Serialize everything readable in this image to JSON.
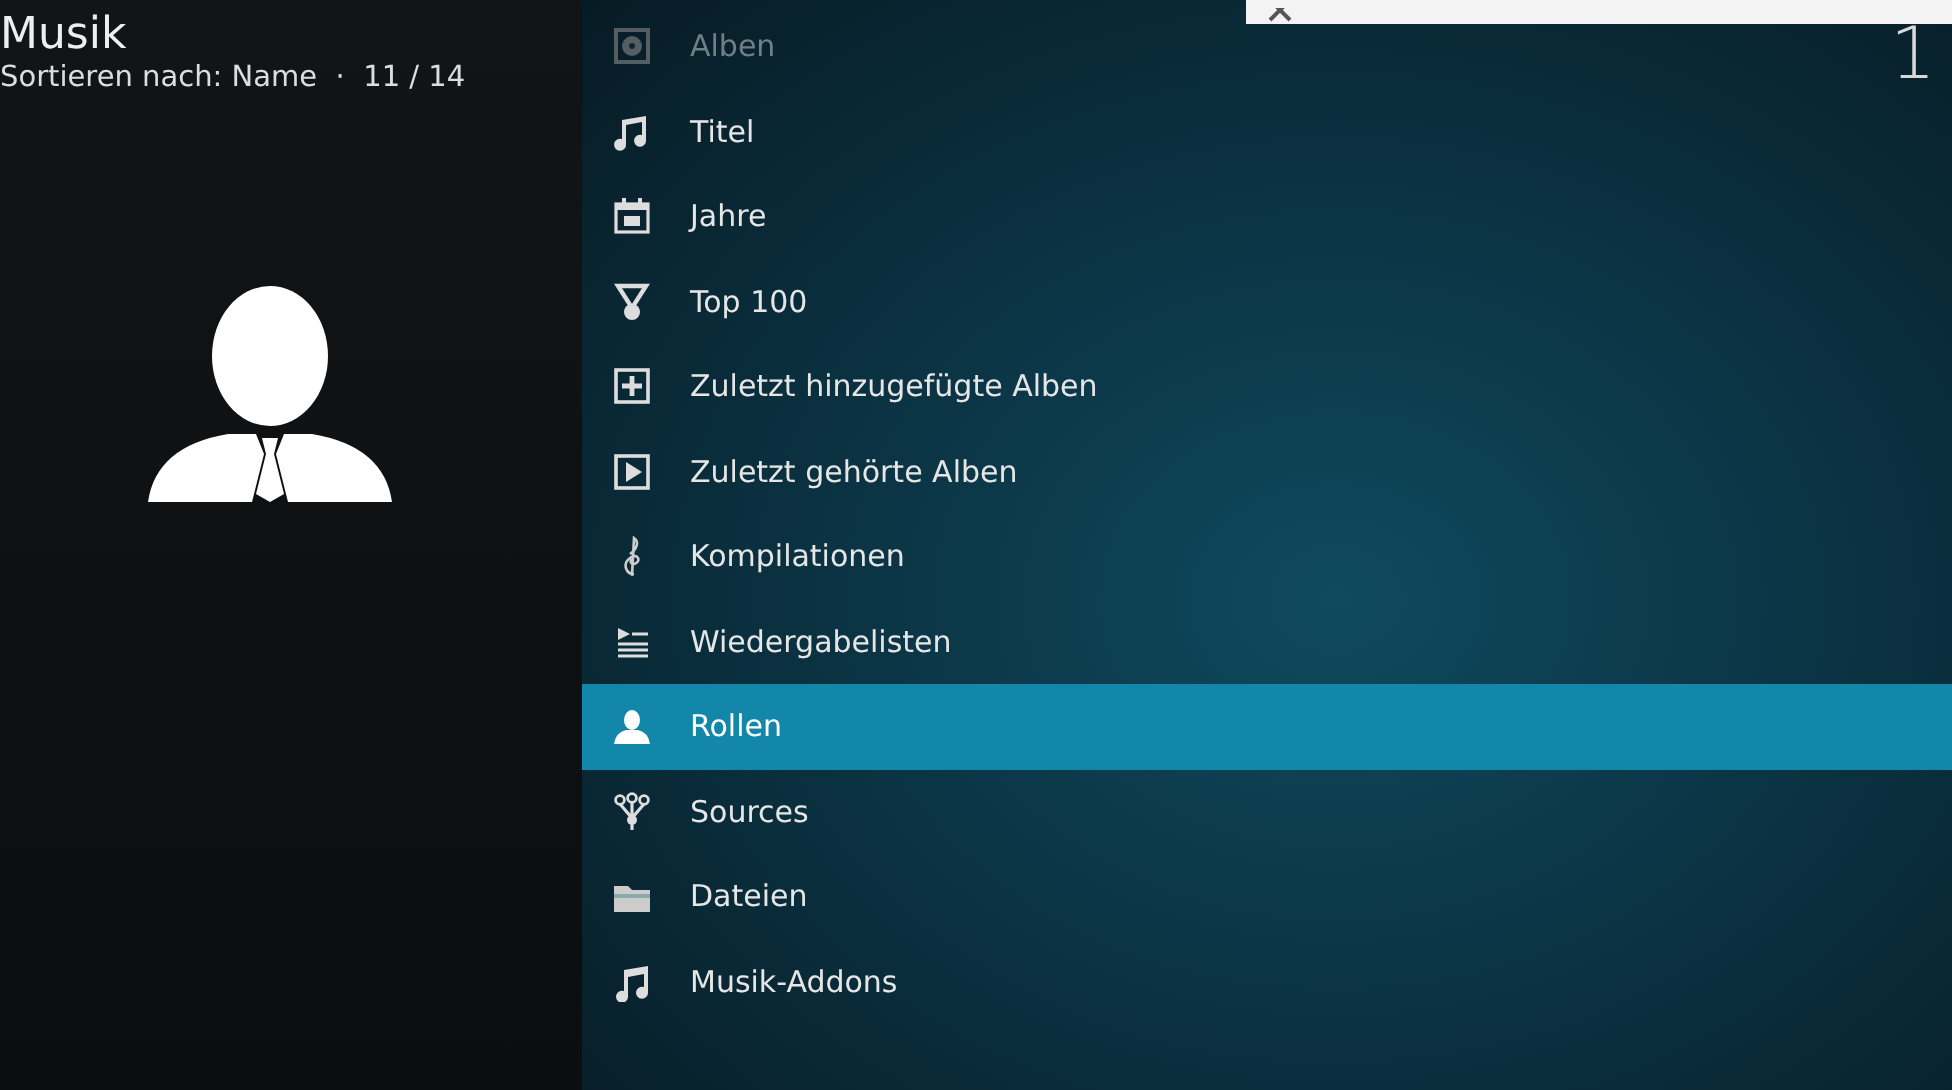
{
  "header": {
    "title": "Musik",
    "sort_info": "Sortieren nach: Name  ·  11 / 14"
  },
  "clock": {
    "time": "1"
  },
  "menu": {
    "items": [
      {
        "label": "Alben",
        "selected": false,
        "faded": true
      },
      {
        "label": "Titel",
        "selected": false,
        "faded": false
      },
      {
        "label": "Jahre",
        "selected": false,
        "faded": false
      },
      {
        "label": "Top 100",
        "selected": false,
        "faded": false
      },
      {
        "label": "Zuletzt hinzugefügte Alben",
        "selected": false,
        "faded": false
      },
      {
        "label": "Zuletzt gehörte Alben",
        "selected": false,
        "faded": false
      },
      {
        "label": "Kompilationen",
        "selected": false,
        "faded": false
      },
      {
        "label": "Wiedergabelisten",
        "selected": false,
        "faded": false
      },
      {
        "label": "Rollen",
        "selected": true,
        "faded": false
      },
      {
        "label": "Sources",
        "selected": false,
        "faded": false
      },
      {
        "label": "Dateien",
        "selected": false,
        "faded": false
      },
      {
        "label": "Musik-Addons",
        "selected": false,
        "faded": false
      }
    ]
  }
}
